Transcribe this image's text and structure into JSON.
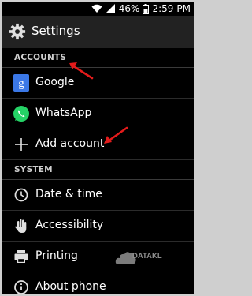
{
  "status_bar": {
    "battery": "46%",
    "time": "2:59",
    "ampm": "PM"
  },
  "action_bar": {
    "title": "Settings"
  },
  "sections": [
    {
      "header": "ACCOUNTS",
      "items": [
        {
          "label": "Google",
          "icon": "google-icon"
        },
        {
          "label": "WhatsApp",
          "icon": "whatsapp-icon"
        },
        {
          "label": "Add account",
          "icon": "plus-icon"
        }
      ]
    },
    {
      "header": "SYSTEM",
      "items": [
        {
          "label": "Date & time",
          "icon": "clock-icon"
        },
        {
          "label": "Accessibility",
          "icon": "hand-icon"
        },
        {
          "label": "Printing",
          "icon": "printer-icon"
        },
        {
          "label": "About phone",
          "icon": "info-icon"
        }
      ]
    }
  ],
  "watermark": "DATAKL",
  "colors": {
    "background": "#000000",
    "action_bar": "#222222",
    "annotation_arrow": "#e31b1b",
    "google_blue": "#3b78e7",
    "whatsapp_green": "#25d366"
  }
}
